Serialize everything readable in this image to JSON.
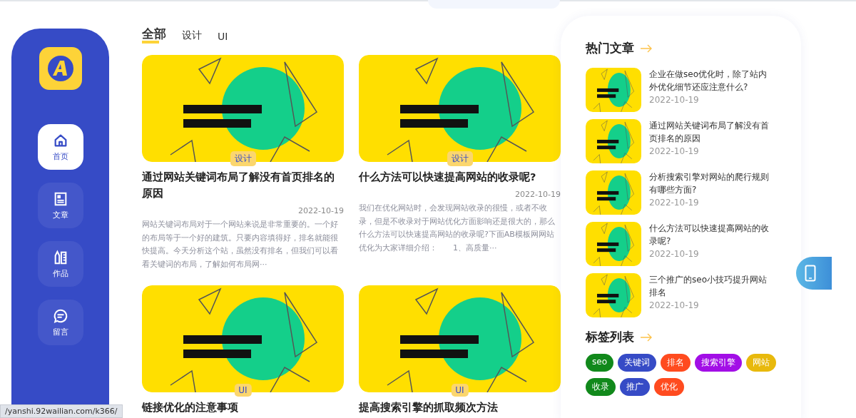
{
  "sidebar": {
    "items": [
      {
        "label": "首页",
        "selected": true
      },
      {
        "label": "文章",
        "selected": false
      },
      {
        "label": "作品",
        "selected": false
      },
      {
        "label": "留言",
        "selected": false
      }
    ]
  },
  "tabs": [
    {
      "label": "全部",
      "selected": true
    },
    {
      "label": "设计",
      "selected": false
    },
    {
      "label": "UI",
      "selected": false
    }
  ],
  "articles": [
    {
      "category": "设计",
      "title": "通过网站关键词布局了解没有首页排名的原因",
      "date": "2022-10-19",
      "excerpt": "网站关键词布局对于一个网站来说是非常重要的。一个好的布局等于一个好的建筑。只要内容填得好，排名就能很快提高。今天分析这个站，虽然没有排名，但我们可以看看关键词的布局，了解如何布局网···"
    },
    {
      "category": "设计",
      "title": "什么方法可以快速提高网站的收录呢?",
      "date": "2022-10-19",
      "excerpt": "我们在优化网站时，会发现网站收录的很慢，或者不收录，但是不收录对于网站优化方面影响还是很大的，那么什么方法可以快速提高网站的收录呢?下面AB模板网网站优化为大家详细介绍：　　1、高质量···"
    },
    {
      "category": "UI",
      "title": "链接优化的注意事项"
    },
    {
      "category": "UI",
      "title": "提高搜索引擎的抓取频次方法"
    }
  ],
  "hot_articles": {
    "title": "热门文章",
    "items": [
      {
        "title": "企业在做seo优化时，除了站内外优化细节还应注意什么?",
        "date": "2022-10-19"
      },
      {
        "title": "通过网站关键词布局了解没有首页排名的原因",
        "date": "2022-10-19"
      },
      {
        "title": "分析搜索引擎对网站的爬行规则有哪些方面?",
        "date": "2022-10-19"
      },
      {
        "title": "什么方法可以快速提高网站的收录呢?",
        "date": "2022-10-19"
      },
      {
        "title": "三个推广的seo小技巧提升网站排名",
        "date": "2022-10-19"
      }
    ]
  },
  "tag_list": {
    "title": "标签列表",
    "tags": [
      {
        "label": "seo",
        "color": "#11891b"
      },
      {
        "label": "关键词",
        "color": "#364bc6"
      },
      {
        "label": "排名",
        "color": "#ff4b1f"
      },
      {
        "label": "搜索引擎",
        "color": "#a20ee6"
      },
      {
        "label": "网站",
        "color": "#e8b90c"
      },
      {
        "label": "收录",
        "color": "#11891b"
      },
      {
        "label": "推广",
        "color": "#364bc6"
      },
      {
        "label": "优化",
        "color": "#ff4b1f"
      }
    ]
  },
  "status_bar": {
    "url": "/yanshi.92wailian.com/k366/"
  }
}
